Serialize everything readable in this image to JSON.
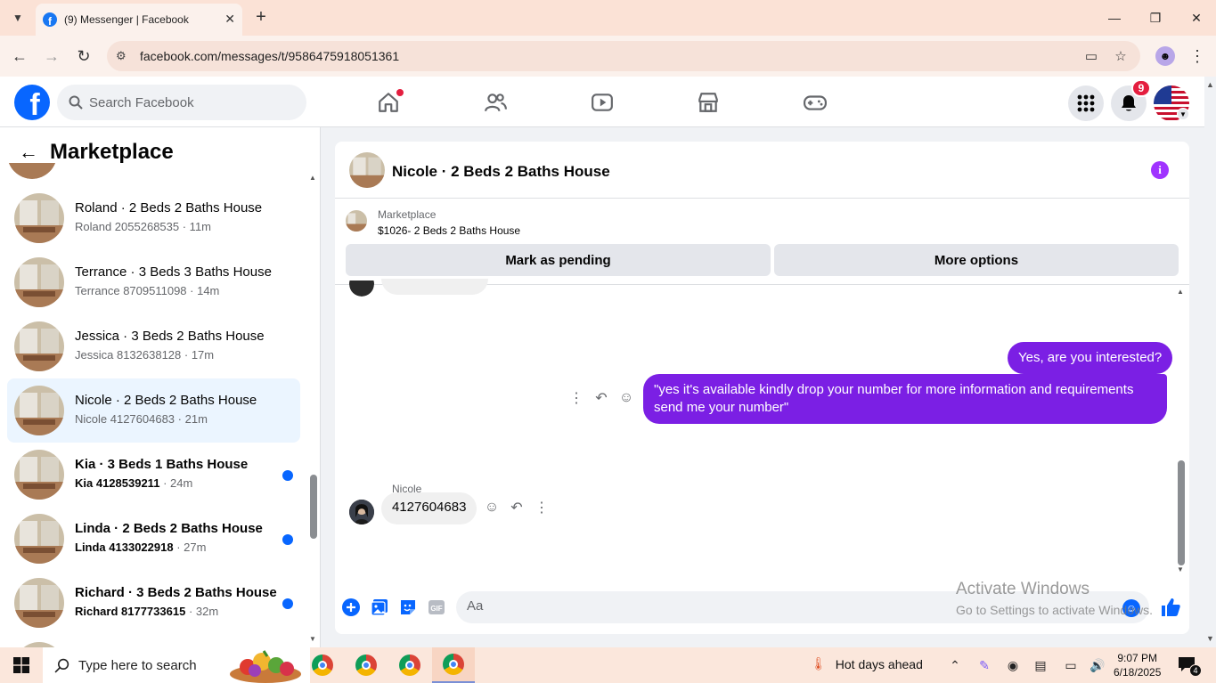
{
  "browser": {
    "tab_title": "(9) Messenger | Facebook",
    "url": "facebook.com/messages/t/9586475918051361"
  },
  "facebook": {
    "search_placeholder": "Search Facebook",
    "notification_count": "9"
  },
  "left_panel": {
    "title": "Marketplace",
    "conversations": [
      {
        "title": "Roland · 2 Beds 2 Baths House",
        "who": "Roland 2055268535",
        "time": "· 11m",
        "unread": false,
        "active": false
      },
      {
        "title": "Terrance · 3 Beds 3 Baths House",
        "who": "Terrance 8709511098",
        "time": "· 14m",
        "unread": false,
        "active": false
      },
      {
        "title": "Jessica · 3 Beds 2 Baths House",
        "who": "Jessica 8132638128",
        "time": "· 17m",
        "unread": false,
        "active": false
      },
      {
        "title": "Nicole · 2 Beds 2 Baths House",
        "who": "Nicole 4127604683",
        "time": "· 21m",
        "unread": false,
        "active": true
      },
      {
        "title": "Kia · 3 Beds 1 Baths House",
        "who": "Kia 4128539211",
        "time": "· 24m",
        "unread": true,
        "active": false
      },
      {
        "title": "Linda · 2 Beds 2 Baths House",
        "who": "Linda 4133022918",
        "time": "· 27m",
        "unread": true,
        "active": false
      },
      {
        "title": "Richard · 3 Beds 2 Baths House",
        "who": "Richard 8177733615",
        "time": "· 32m",
        "unread": true,
        "active": false
      }
    ]
  },
  "chat": {
    "title": "Nicole · 2 Beds 2 Baths House",
    "listing": {
      "category": "Marketplace",
      "price_title": "$1026- 2 Beds 2 Baths House",
      "mark_pending_label": "Mark as pending",
      "more_options_label": "More options"
    },
    "messages": {
      "out_1": "Yes, are you interested?",
      "out_2": "\"yes it's available kindly drop your number for more information and requirements send me your number\"",
      "in_sender": "Nicole",
      "in_1": "4127604683"
    },
    "composer_placeholder": "Aa"
  },
  "watermark": {
    "line1": "Activate Windows",
    "line2": "Go to Settings to activate Windows."
  },
  "taskbar": {
    "search_placeholder": "Type here to search",
    "weather": "Hot days ahead",
    "time": "9:07 PM",
    "date": "6/18/2025",
    "notification_count": "4"
  },
  "colors": {
    "fb_blue": "#0866ff",
    "outgoing_bubble": "#7b1fe4",
    "unread_dot": "#0866ff",
    "badge_red": "#e41e3f"
  }
}
